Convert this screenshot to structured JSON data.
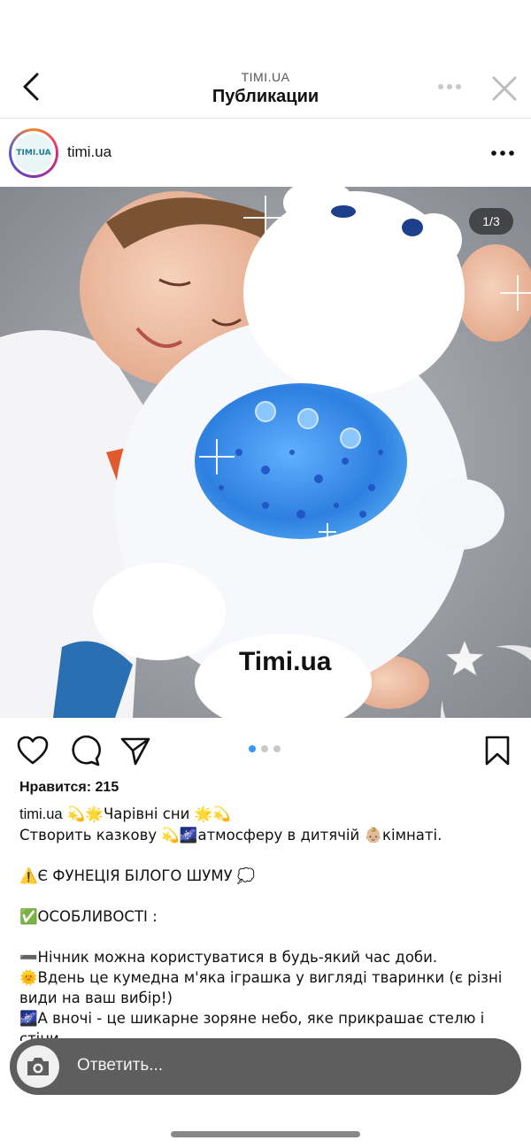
{
  "nav": {
    "subtitle": "TIMI.UA",
    "title": "Публикации"
  },
  "post": {
    "avatar_text": "TIMI.UA",
    "username": "timi.ua",
    "image_counter": "1/3",
    "watermark": "Timi.ua",
    "likes": "Нравится: 215",
    "caption": {
      "line1_user": "timi.ua",
      "line1_text": " 💫🌟Чарівні сни 🌟💫",
      "line2": "Створить казкову 💫🌌атмосферу в дитячій 👶🏼кімнаті.",
      "line3": "⚠️Є ФУНЕЦІЯ БІЛОГО ШУМУ 💭",
      "line4": "✅ОСОБЛИВОСТІ :",
      "line5": "➖Нічник можна користуватися в будь-який час доби.",
      "line6": "🌞Вдень це кумедна м'яка іграшка у вигляді тваринки (є різні види на ваш вибір!)",
      "line7": "🌌А вночі - це шикарне зоряне небо, яке прикрашає стелю і стіни."
    },
    "carousel": {
      "total": 3,
      "active": 1
    }
  },
  "reply": {
    "placeholder": "Ответить..."
  },
  "colors": {
    "accent": "#3897f0",
    "reply_bar": "#5e5e5e",
    "projector_blue": "#2f7fe0"
  }
}
